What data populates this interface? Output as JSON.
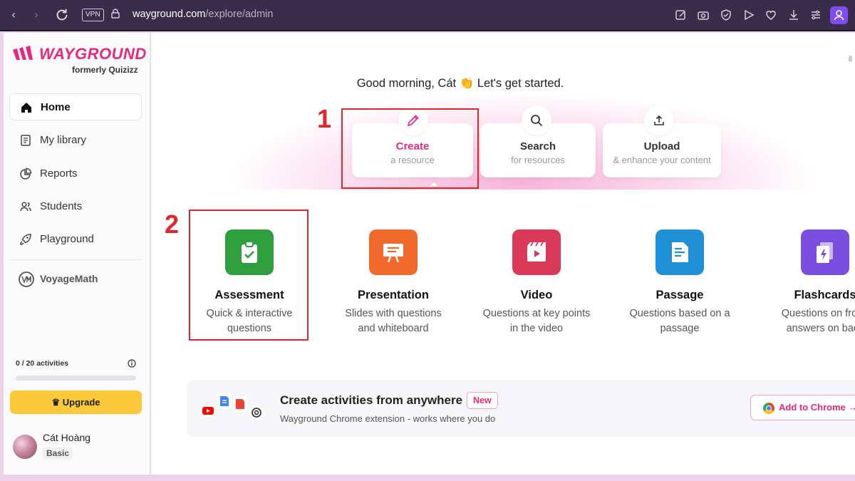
{
  "browser": {
    "vpn_label": "VPN",
    "url_host": "wayground.com",
    "url_path": "/explore/admin"
  },
  "sidebar": {
    "logo": "WAYGROUND",
    "logo_sub": "formerly Quizizz",
    "items": [
      {
        "label": "Home",
        "icon": "home-icon",
        "active": true
      },
      {
        "label": "My library",
        "icon": "library-icon"
      },
      {
        "label": "Reports",
        "icon": "reports-icon"
      },
      {
        "label": "Students",
        "icon": "students-icon"
      },
      {
        "label": "Playground",
        "icon": "rocket-icon"
      }
    ],
    "voyage_label": "VoyageMath",
    "activities": "0 / 20 activities",
    "activities_progress": 0,
    "upgrade_label": "Upgrade",
    "user": {
      "name": "Cát Hoàng",
      "plan": "Basic"
    }
  },
  "main": {
    "greeting": "Good morning, Cát 👏 Let's get started.",
    "actions": [
      {
        "title": "Create",
        "subtitle": "a resource",
        "icon": "pencil-icon",
        "active": true
      },
      {
        "title": "Search",
        "subtitle": "for resources",
        "icon": "search-icon"
      },
      {
        "title": "Upload",
        "subtitle": "& enhance your content",
        "icon": "upload-icon"
      }
    ],
    "annotations": [
      "1",
      "2"
    ],
    "resources": [
      {
        "title": "Assessment",
        "desc": "Quick & interactive questions",
        "color": "#2e9e3e"
      },
      {
        "title": "Presentation",
        "desc": "Slides with questions and whiteboard",
        "color": "#ef6a2c"
      },
      {
        "title": "Video",
        "desc": "Questions at key points in the video",
        "color": "#d93a5a"
      },
      {
        "title": "Passage",
        "desc": "Questions based on a passage",
        "color": "#1f8fd6"
      },
      {
        "title": "Flashcards",
        "desc": "Questions on front, answers on back",
        "color": "#7a4fe0"
      }
    ],
    "banner": {
      "title": "Create activities from anywhere",
      "badge": "New",
      "subtitle": "Wayground Chrome extension - works where you do",
      "button": "Add to Chrome →"
    }
  },
  "colors": {
    "brand": "#e6297c",
    "annotation": "#e0262c",
    "upgrade": "#fcc93b"
  }
}
